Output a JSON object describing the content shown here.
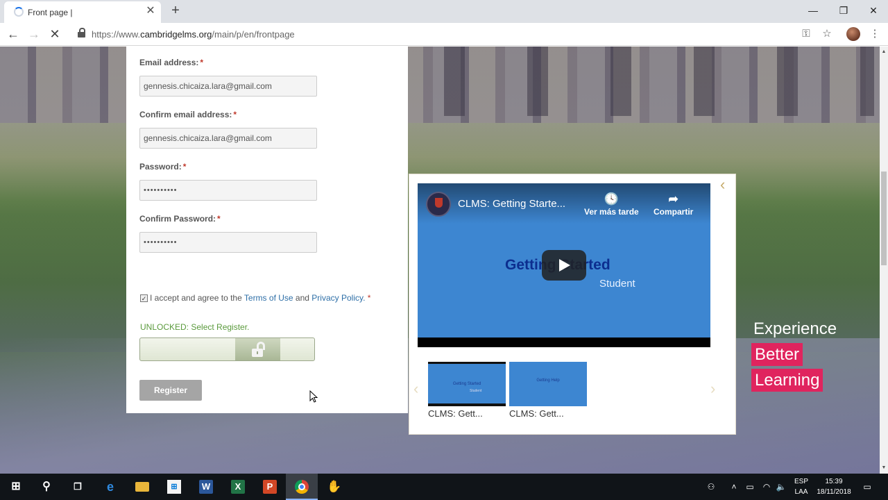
{
  "browser": {
    "tab_title": "Front page |",
    "tab_close": "✕",
    "new_tab": "+",
    "url_prefix": "https://www.",
    "url_host": "cambridgelms.org",
    "url_path": "/main/p/en/frontpage",
    "window_controls": {
      "minimize": "—",
      "maximize": "❐",
      "close": "✕"
    }
  },
  "form": {
    "email_label": "Email address:",
    "email_value": "gennesis.chicaiza.lara@gmail.com",
    "confirm_email_label": "Confirm email address:",
    "confirm_email_value": "gennesis.chicaiza.lara@gmail.com",
    "password_label": "Password:",
    "password_value": "••••••••••",
    "confirm_password_label": "Confirm Password:",
    "confirm_password_value": "••••••••••",
    "required_mark": "*",
    "accept_text_1": "I accept and agree to the",
    "terms_link": "Terms of Use",
    "accept_text_2": "and",
    "privacy_link": "Privacy Policy.",
    "accept_checked": true,
    "unlock_status": "UNLOCKED: Select Register.",
    "register_button": "Register"
  },
  "video": {
    "title": "CLMS: Getting Starte...",
    "watch_later": "Ver más tarde",
    "share": "Compartir",
    "slide_title": "Getting Started",
    "slide_subtitle": "Student",
    "thumbnails": [
      {
        "text": "Getting Started",
        "sub": "Student",
        "caption": "CLMS: Gett..."
      },
      {
        "text": "Getting Help",
        "sub": "",
        "caption": "CLMS: Gett..."
      }
    ]
  },
  "slogan": {
    "line1": "Experience",
    "line2": "Better",
    "line3": "Learning"
  },
  "taskbar": {
    "language_1": "ESP",
    "language_2": "LAA",
    "time": "15:39",
    "date": "18/11/2018"
  },
  "colors": {
    "accent_link": "#2e6fa7",
    "required": "#c0392b",
    "unlocked_green": "#5a9a3c",
    "slogan_pink": "#e0245e",
    "video_blue": "#3d86d1"
  }
}
